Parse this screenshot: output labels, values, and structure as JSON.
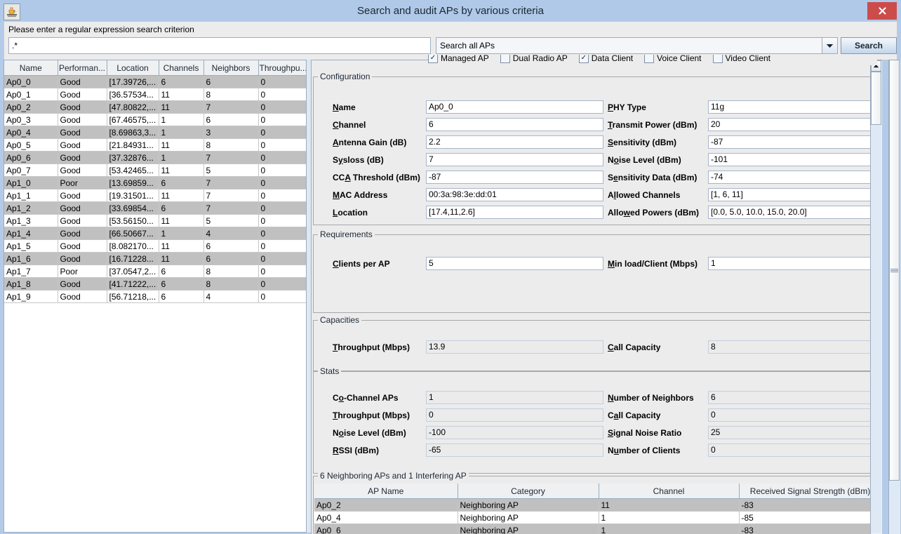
{
  "window": {
    "title": "Search and audit APs by various criteria",
    "icon": "java-coffee-cup-icon",
    "close_label": "✕"
  },
  "search": {
    "prompt": "Please enter a regular expression search criterion",
    "regex_value": ".*",
    "regex_placeholder": "",
    "scope_selected": "Search all APs",
    "scope_options": [
      "Search all APs"
    ],
    "button_label": "Search",
    "filters": [
      {
        "label": "Managed AP",
        "checked": true
      },
      {
        "label": "Dual Radio AP",
        "checked": false
      },
      {
        "label": "Data Client",
        "checked": true
      },
      {
        "label": "Voice Client",
        "checked": false
      },
      {
        "label": "Video Client",
        "checked": false
      }
    ]
  },
  "ap_table": {
    "columns": [
      "Name",
      "Performan...",
      "Location",
      "Channels",
      "Neighbors",
      "Throughpu..."
    ],
    "rows": [
      {
        "name": "Ap0_0",
        "performance": "Good",
        "location": "[17.39726,...",
        "channels": "6",
        "neighbors": "6",
        "throughput": "0",
        "selected": true
      },
      {
        "name": "Ap0_1",
        "performance": "Good",
        "location": "[36.57534...",
        "channels": "11",
        "neighbors": "8",
        "throughput": "0",
        "selected": false
      },
      {
        "name": "Ap0_2",
        "performance": "Good",
        "location": "[47.80822,...",
        "channels": "11",
        "neighbors": "7",
        "throughput": "0",
        "selected": true
      },
      {
        "name": "Ap0_3",
        "performance": "Good",
        "location": "[67.46575,...",
        "channels": "1",
        "neighbors": "6",
        "throughput": "0",
        "selected": false
      },
      {
        "name": "Ap0_4",
        "performance": "Good",
        "location": "[8.69863,3...",
        "channels": "1",
        "neighbors": "3",
        "throughput": "0",
        "selected": true
      },
      {
        "name": "Ap0_5",
        "performance": "Good",
        "location": "[21.84931...",
        "channels": "11",
        "neighbors": "8",
        "throughput": "0",
        "selected": false
      },
      {
        "name": "Ap0_6",
        "performance": "Good",
        "location": "[37.32876...",
        "channels": "1",
        "neighbors": "7",
        "throughput": "0",
        "selected": true
      },
      {
        "name": "Ap0_7",
        "performance": "Good",
        "location": "[53.42465...",
        "channels": "11",
        "neighbors": "5",
        "throughput": "0",
        "selected": false
      },
      {
        "name": "Ap1_0",
        "performance": "Poor",
        "location": "[13.69859...",
        "channels": "6",
        "neighbors": "7",
        "throughput": "0",
        "selected": true
      },
      {
        "name": "Ap1_1",
        "performance": "Good",
        "location": "[19.31501...",
        "channels": "11",
        "neighbors": "7",
        "throughput": "0",
        "selected": false
      },
      {
        "name": "Ap1_2",
        "performance": "Good",
        "location": "[33.69854...",
        "channels": "6",
        "neighbors": "7",
        "throughput": "0",
        "selected": true
      },
      {
        "name": "Ap1_3",
        "performance": "Good",
        "location": "[53.56150...",
        "channels": "11",
        "neighbors": "5",
        "throughput": "0",
        "selected": false
      },
      {
        "name": "Ap1_4",
        "performance": "Good",
        "location": "[66.50667...",
        "channels": "1",
        "neighbors": "4",
        "throughput": "0",
        "selected": true
      },
      {
        "name": "Ap1_5",
        "performance": "Good",
        "location": "[8.082170...",
        "channels": "11",
        "neighbors": "6",
        "throughput": "0",
        "selected": false
      },
      {
        "name": "Ap1_6",
        "performance": "Good",
        "location": "[16.71228...",
        "channels": "11",
        "neighbors": "6",
        "throughput": "0",
        "selected": true
      },
      {
        "name": "Ap1_7",
        "performance": "Poor",
        "location": "[37.0547,2...",
        "channels": "6",
        "neighbors": "8",
        "throughput": "0",
        "selected": false
      },
      {
        "name": "Ap1_8",
        "performance": "Good",
        "location": "[41.71222,...",
        "channels": "6",
        "neighbors": "8",
        "throughput": "0",
        "selected": true
      },
      {
        "name": "Ap1_9",
        "performance": "Good",
        "location": "[56.71218,...",
        "channels": "6",
        "neighbors": "4",
        "throughput": "0",
        "selected": false
      }
    ]
  },
  "configuration": {
    "title": "Configuration",
    "left": [
      {
        "label": "Name",
        "mnemonic": "N",
        "value": "Ap0_0"
      },
      {
        "label": "Channel",
        "mnemonic": "C",
        "value": "6"
      },
      {
        "label": "Antenna Gain (dB)",
        "mnemonic": "A",
        "value": "2.2"
      },
      {
        "label": "Sysloss (dB)",
        "mnemonic": "y",
        "value": "7"
      },
      {
        "label": "CCA Threshold (dBm)",
        "mnemonic": "A",
        "value": "-87"
      },
      {
        "label": "MAC Address",
        "mnemonic": "M",
        "value": "00:3a:98:3e:dd:01"
      },
      {
        "label": "Location",
        "mnemonic": "L",
        "value": "[17.4,11,2.6]"
      }
    ],
    "right": [
      {
        "label": "PHY Type",
        "mnemonic": "P",
        "value": "11g"
      },
      {
        "label": "Transmit Power (dBm)",
        "mnemonic": "T",
        "value": "20"
      },
      {
        "label": "Sensitivity (dBm)",
        "mnemonic": "S",
        "value": "-87"
      },
      {
        "label": "Noise Level (dBm)",
        "mnemonic": "o",
        "value": "-101"
      },
      {
        "label": "Sensitivity Data (dBm)",
        "mnemonic": "e",
        "value": "-74"
      },
      {
        "label": "Allowed Channels",
        "mnemonic": "l",
        "value": "[1, 6, 11]"
      },
      {
        "label": "Allowed Powers (dBm)",
        "mnemonic": "w",
        "value": "[0.0, 5.0, 10.0, 15.0, 20.0]"
      }
    ]
  },
  "requirements": {
    "title": "Requirements",
    "left": [
      {
        "label": "Clients per AP",
        "mnemonic": "C",
        "value": "5"
      }
    ],
    "right": [
      {
        "label": "Min load/Client (Mbps)",
        "mnemonic": "M",
        "value": "1"
      }
    ]
  },
  "capacities": {
    "title": "Capacities",
    "left": [
      {
        "label": "Throughput (Mbps)",
        "mnemonic": "T",
        "value": "13.9"
      }
    ],
    "right": [
      {
        "label": "Call Capacity",
        "mnemonic": "C",
        "value": "8"
      }
    ]
  },
  "stats": {
    "title": "Stats",
    "left": [
      {
        "label": "Co-Channel APs",
        "mnemonic": "o",
        "value": "1"
      },
      {
        "label": "Throughput (Mbps)",
        "mnemonic": "T",
        "value": "0"
      },
      {
        "label": "Noise Level (dBm)",
        "mnemonic": "o",
        "value": "-100"
      },
      {
        "label": "RSSI (dBm)",
        "mnemonic": "R",
        "value": "-65"
      }
    ],
    "right": [
      {
        "label": "Number of Neighbors",
        "mnemonic": "N",
        "value": "6"
      },
      {
        "label": "Call Capacity",
        "mnemonic": "a",
        "value": "0"
      },
      {
        "label": "Signal Noise Ratio",
        "mnemonic": "S",
        "value": "25"
      },
      {
        "label": "Number of Clients",
        "mnemonic": "u",
        "value": "0"
      }
    ]
  },
  "neighbors": {
    "title": "6 Neighboring APs and 1 Interfering AP",
    "columns": [
      "AP Name",
      "Category",
      "Channel",
      "Received Signal Strength (dBm)"
    ],
    "rows": [
      {
        "ap_name": "Ap0_2",
        "category": "Neighboring AP",
        "channel": "11",
        "rss": "-83",
        "selected": true
      },
      {
        "ap_name": "Ap0_4",
        "category": "Neighboring AP",
        "channel": "1",
        "rss": "-85",
        "selected": false
      },
      {
        "ap_name": "Ap0_6",
        "category": "Neighboring AP",
        "channel": "1",
        "rss": "-83",
        "selected": true
      }
    ]
  },
  "colors": {
    "titlebar": "#b0c9e8",
    "close_button": "#cc4c4c",
    "panel_bg": "#ececed",
    "row_selected": "#c0c0c0",
    "field_border": "#a7b6c8"
  }
}
